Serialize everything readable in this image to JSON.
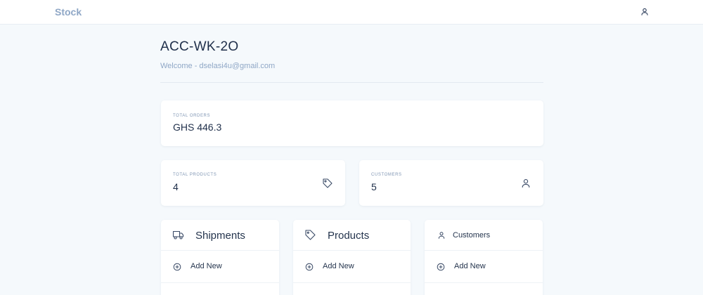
{
  "navbar": {
    "brand": "Stock",
    "user_icon": "user-icon"
  },
  "header": {
    "title": "ACC-WK-2O",
    "welcome": "Welcome - dselasi4u@gmail.com"
  },
  "stats": {
    "total_orders": {
      "label": "TOTAL ORDERS",
      "value": "GHS 446.3"
    },
    "total_products": {
      "label": "TOTAL PRODUCTS",
      "value": "4",
      "icon": "tag-icon"
    },
    "customers": {
      "label": "CUSTOMERS",
      "value": "5",
      "icon": "user-icon"
    }
  },
  "panels": [
    {
      "title": "Shipments",
      "icon": "truck-icon",
      "add_label": "Add New"
    },
    {
      "title": "Products",
      "icon": "tag-icon",
      "add_label": "Add New"
    },
    {
      "title": "Customers",
      "icon": "user-icon",
      "add_label": "Add New"
    }
  ],
  "colors": {
    "background": "#f5f9fc",
    "card": "#ffffff",
    "brand": "#8fa7c6",
    "text": "#24344d",
    "muted": "#7f95b3"
  }
}
